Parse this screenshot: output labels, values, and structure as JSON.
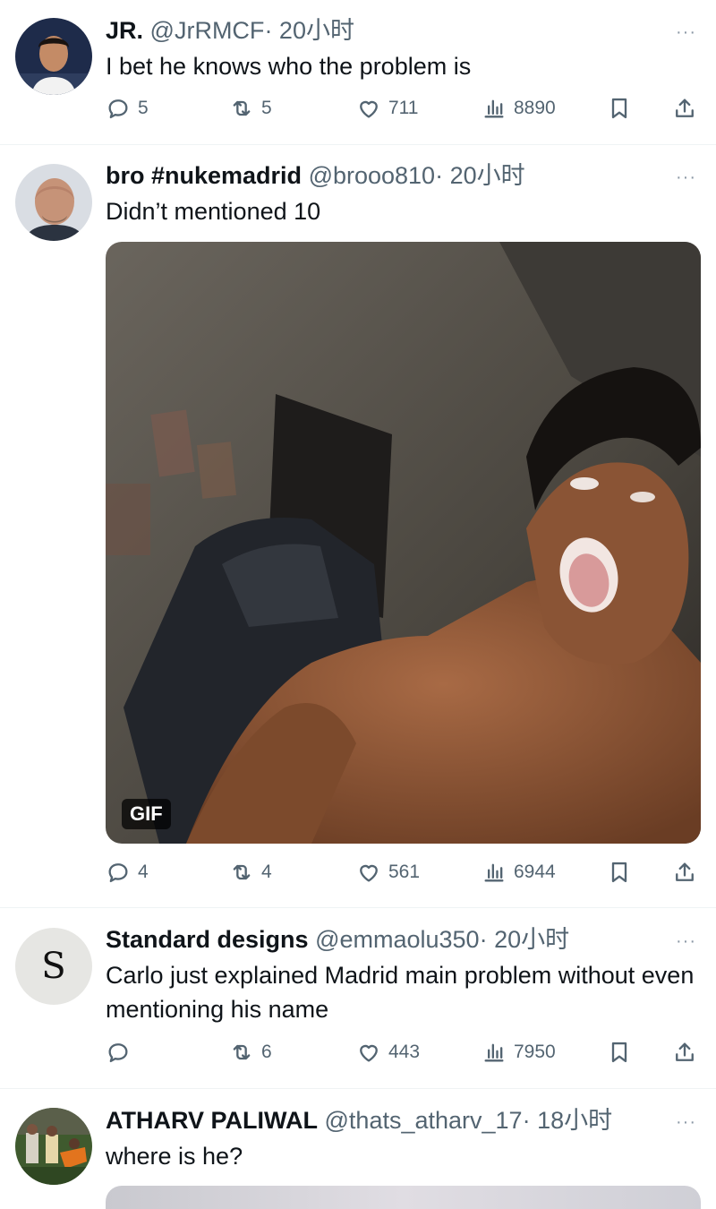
{
  "tweets": [
    {
      "name": "JR.",
      "handle": "@JrRMCF",
      "time": "· 20小时",
      "text": "I bet he knows who the problem is",
      "replies": "5",
      "retweets": "5",
      "likes": "711",
      "views": "8890"
    },
    {
      "name": "bro #nukemadrid",
      "handle": "@brooo810",
      "time": "· 20小时",
      "text": "Didn’t mentioned 10",
      "gif_label": "GIF",
      "replies": "4",
      "retweets": "4",
      "likes": "561",
      "views": "6944"
    },
    {
      "name": "Standard designs",
      "handle": "@emmaolu350",
      "time": "· 20小时",
      "avatar_letter": "S",
      "text": "Carlo just explained Madrid main problem without even mentioning his name",
      "replies": "",
      "retweets": "6",
      "likes": "443",
      "views": "7950"
    },
    {
      "name": "ATHARV PALIWAL",
      "handle": "@thats_atharv_17",
      "time": "· 18小时",
      "text": "where is he?"
    }
  ],
  "more_glyph": "···",
  "icons": [
    "reply-icon",
    "retweet-icon",
    "like-icon",
    "views-icon",
    "bookmark-icon",
    "share-icon",
    "more-icon"
  ]
}
